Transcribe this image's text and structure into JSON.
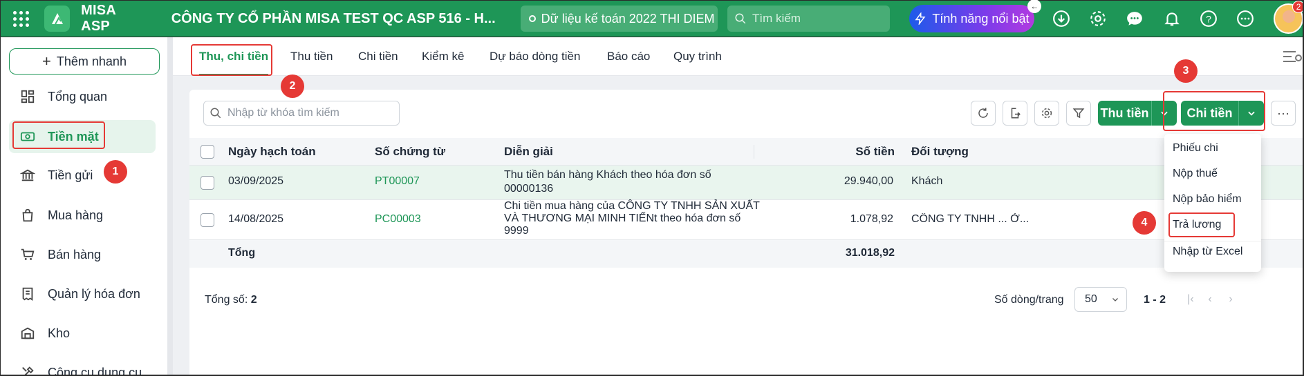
{
  "topbar": {
    "brand": "MISA ASP",
    "company": "CÔNG TY CỔ PHẦN MISA TEST QC ASP 516 - H...",
    "data_source": "Dữ liệu kế toán 2022 THI DIEM",
    "search_placeholder": "Tìm kiếm",
    "feature_label": "Tính năng nổi bật",
    "notification_count": "2",
    "icons": [
      "apps-grid-icon",
      "misa-logo-icon",
      "search-icon",
      "lightning-icon",
      "download-icon",
      "gear-icon",
      "chat-icon",
      "bell-icon",
      "help-icon",
      "more-icon",
      "avatar"
    ]
  },
  "sidebar": {
    "quick_add": "Thêm nhanh",
    "items": [
      {
        "label": "Tổng quan",
        "icon": "dashboard-icon"
      },
      {
        "label": "Tiền mặt",
        "icon": "cash-icon",
        "active": true
      },
      {
        "label": "Tiền gửi",
        "icon": "bank-icon"
      },
      {
        "label": "Mua hàng",
        "icon": "shopping-bag-icon"
      },
      {
        "label": "Bán hàng",
        "icon": "cart-icon"
      },
      {
        "label": "Quản lý hóa đơn",
        "icon": "invoice-icon"
      },
      {
        "label": "Kho",
        "icon": "warehouse-icon"
      },
      {
        "label": "Công cụ dụng cụ",
        "icon": "tools-icon"
      }
    ]
  },
  "tabs": [
    "Thu, chi tiền",
    "Thu tiền",
    "Chi tiền",
    "Kiểm kê",
    "Dự báo dòng tiền",
    "Báo cáo",
    "Quy trình"
  ],
  "toolbar": {
    "search_placeholder": "Nhập từ khóa tìm kiếm",
    "receive_button": "Thu tiền",
    "pay_button": "Chi tiền"
  },
  "table": {
    "columns": [
      "Ngày hạch toán",
      "Số chứng từ",
      "Diễn giải",
      "Số tiền",
      "Đối tượng"
    ],
    "rows": [
      {
        "date": "03/09/2025",
        "voucher": "PT00007",
        "desc_lines": [
          "Thu tiền bán hàng Khách theo hóa đơn số",
          "00000136"
        ],
        "amount": "29.940,00",
        "party": "Khách"
      },
      {
        "date": "14/08/2025",
        "voucher": "PC00003",
        "desc_lines": [
          "Chi tiền mua hàng của CÔNG TY TNHH SẢN XUẤT",
          "VÀ THƯƠNG MẠI MINH TIẾNt theo hóa đơn số",
          "9999"
        ],
        "amount": "1.078,92",
        "party": "CÔNG TY TNHH ... Ở..."
      }
    ],
    "total_label": "Tổng",
    "total_amount": "31.018,92"
  },
  "footer": {
    "total_count_label": "Tổng số:",
    "total_count": "2",
    "rows_per_page_label": "Số dòng/trang",
    "rows_per_page": "50",
    "page_range": "1 - 2"
  },
  "dropdown": {
    "items": [
      "Phiếu chi",
      "Nộp thuế",
      "Nộp bảo hiểm",
      "Trả lương",
      "Nhập từ Excel"
    ]
  },
  "steps": [
    "1",
    "2",
    "3",
    "4"
  ],
  "colors": {
    "brand_green": "#1e9657",
    "highlight_red": "#e53935",
    "feature_gradient_start": "#1d5bea",
    "feature_gradient_end": "#b23be0"
  }
}
